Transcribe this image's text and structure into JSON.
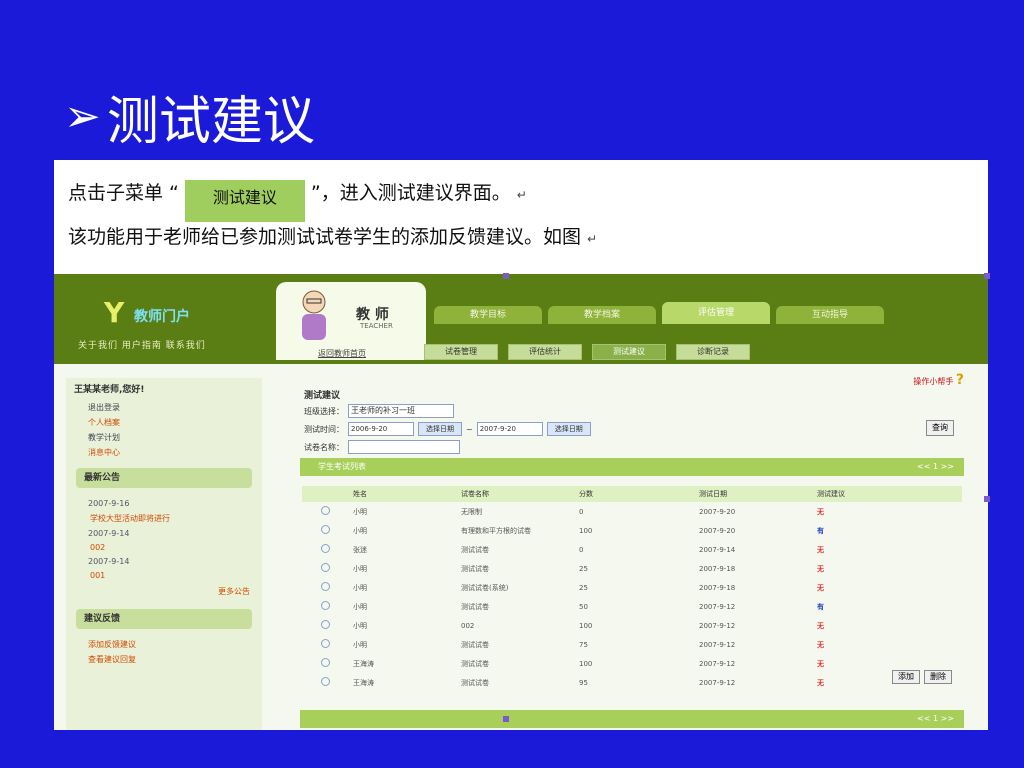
{
  "slide": {
    "arrow": "➢",
    "title": "测试建议"
  },
  "doc": {
    "line1_prefix": "点击子菜单 “",
    "submenu_label": "测试建议",
    "line1_suffix": "”，进入测试建议界面。",
    "line2": "该功能用于老师给已参加测试试卷学生的添加反馈建议。如图",
    "return_mark": "↵"
  },
  "app": {
    "logo_mark": "Y",
    "logo_word": "教师门户",
    "top_links": "关于我们  用户指南  联系我们",
    "teacher": {
      "title": "教 师",
      "subtitle": "TEACHER"
    },
    "main_tabs": [
      "教学目标",
      "教学档案",
      "评估管理",
      "互动指导"
    ],
    "home_link": "返回教师首页",
    "sub_tabs": [
      "试卷管理",
      "评估统计",
      "测试建议",
      "诊断记录"
    ],
    "help_link": "操作小帮手",
    "sidebar": {
      "welcome": "王某某老师,您好!",
      "menu_items": [
        "退出登录",
        "个人档案",
        "教学计划",
        "消息中心"
      ],
      "notice_title": "最新公告",
      "notices": [
        {
          "date": "2007-9-16",
          "text": "学校大型活动即将进行"
        },
        {
          "date": "2007-9-14",
          "text": "002"
        },
        {
          "date": "2007-9-14",
          "text": "001"
        }
      ],
      "more": "更多公告",
      "feedback_title": "建议反馈",
      "feedback_items": [
        "添加反馈建议",
        "查看建议回复"
      ]
    },
    "content": {
      "section_title": "测试建议",
      "class_label": "班级选择：",
      "class_value": "王老师的补习一班",
      "time_label": "测试时间：",
      "date_from": "2006-9-20",
      "date_to": "2007-9-20",
      "pick_date": "选择日期",
      "tilde": "~",
      "paper_label": "试卷名称：",
      "search_button": "查询",
      "list_title": "学生考试列表",
      "pager": "<< 1 >>",
      "columns": [
        "",
        "姓名",
        "试卷名称",
        "分数",
        "测试日期",
        "测试建议"
      ],
      "rows": [
        {
          "name": "小明",
          "paper": "无限制",
          "score": "0",
          "date": "2007-9-20",
          "suggestion": "无"
        },
        {
          "name": "小明",
          "paper": "有理数和平方根的试卷",
          "score": "100",
          "date": "2007-9-20",
          "suggestion": "有"
        },
        {
          "name": "张迷",
          "paper": "测试试卷",
          "score": "0",
          "date": "2007-9-14",
          "suggestion": "无"
        },
        {
          "name": "小明",
          "paper": "测试试卷",
          "score": "25",
          "date": "2007-9-18",
          "suggestion": "无"
        },
        {
          "name": "小明",
          "paper": "测试试卷(系统)",
          "score": "25",
          "date": "2007-9-18",
          "suggestion": "无"
        },
        {
          "name": "小明",
          "paper": "测试试卷",
          "score": "50",
          "date": "2007-9-12",
          "suggestion": "有"
        },
        {
          "name": "小明",
          "paper": "002",
          "score": "100",
          "date": "2007-9-12",
          "suggestion": "无"
        },
        {
          "name": "小明",
          "paper": "测试试卷",
          "score": "75",
          "date": "2007-9-12",
          "suggestion": "无"
        },
        {
          "name": "王海涛",
          "paper": "测试试卷",
          "score": "100",
          "date": "2007-9-12",
          "suggestion": "无"
        },
        {
          "name": "王海涛",
          "paper": "测试试卷",
          "score": "95",
          "date": "2007-9-12",
          "suggestion": "无"
        }
      ],
      "actions": [
        "添加",
        "删除"
      ]
    }
  },
  "colors": {
    "slide_bg": "#1a1ad8",
    "app_green": "#5a7d14",
    "bar_green": "#a8cf5a",
    "tag_green": "#9fce5e",
    "alert_red": "#e03030",
    "link_blue": "#2040c0"
  }
}
